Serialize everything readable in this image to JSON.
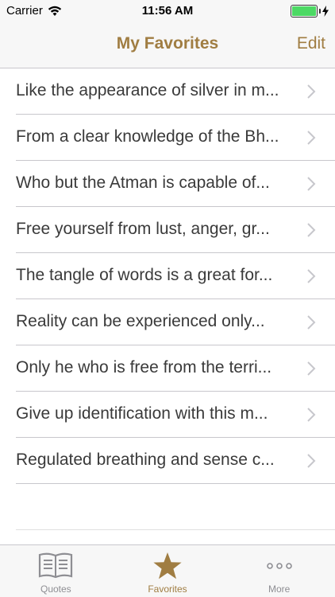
{
  "status": {
    "carrier": "Carrier",
    "time": "11:56 AM",
    "battery_level": 1.0
  },
  "nav": {
    "title": "My Favorites",
    "edit_label": "Edit"
  },
  "favorites": [
    "Like the appearance of silver in m...",
    "From a clear knowledge of the Bh...",
    "Who but the Atman is capable of...",
    "Free yourself from lust, anger, gr...",
    "The tangle of words is a great for...",
    "Reality can be experienced only...",
    "Only he who is free from the terri...",
    "Give up identification with this m...",
    "Regulated breathing and sense c..."
  ],
  "tabs": [
    {
      "label": "Quotes",
      "icon": "book-icon",
      "active": false
    },
    {
      "label": "Favorites",
      "icon": "star-icon",
      "active": true
    },
    {
      "label": "More",
      "icon": "more-dots-icon",
      "active": false
    }
  ],
  "colors": {
    "accent": "#a07d42",
    "battery": "#4cd964",
    "inactive_tab": "#8e8e93"
  }
}
